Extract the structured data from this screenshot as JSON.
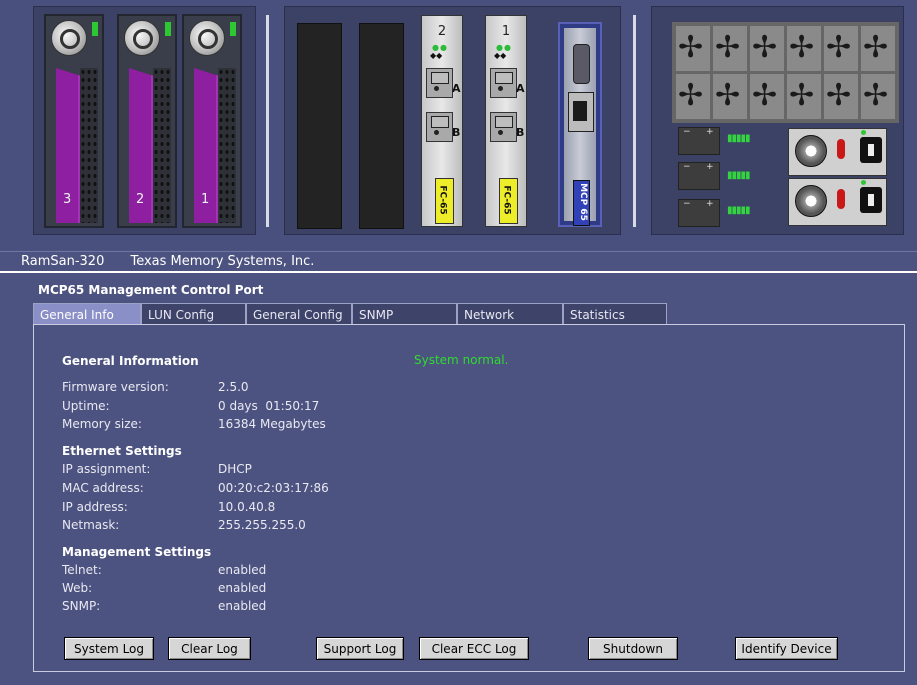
{
  "chassis": {
    "drive_bays": [
      "3",
      "2",
      "1"
    ],
    "fc_cards": [
      {
        "number": "2",
        "ports": [
          "A",
          "B"
        ],
        "label": "FC-65"
      },
      {
        "number": "1",
        "ports": [
          "A",
          "B"
        ],
        "label": "FC-65"
      }
    ],
    "mcp_label": "MCP 65",
    "fan_count": 12,
    "battery_count": 3,
    "psu_count": 2
  },
  "caption": {
    "model": "RamSan-320",
    "vendor": "Texas Memory Systems, Inc."
  },
  "management": {
    "title": "MCP65 Management Control Port",
    "tabs": [
      "General Info",
      "LUN Config",
      "General Config",
      "SNMP",
      "Network",
      "Statistics"
    ],
    "active_tab": "General Info"
  },
  "general": {
    "heading": "General Information",
    "status": "System normal.",
    "status_color": "#2edc2e",
    "firmware_label": "Firmware version:",
    "firmware": "2.5.0",
    "uptime_label": "Uptime:",
    "uptime": "0 days  01:50:17",
    "memory_label": "Memory size:",
    "memory": "16384 Megabytes"
  },
  "ethernet": {
    "heading": "Ethernet Settings",
    "ip_assign_label": "IP assignment:",
    "ip_assign": "DHCP",
    "mac_label": "MAC address:",
    "mac": "00:20:c2:03:17:86",
    "ip_label": "IP address:",
    "ip": "10.0.40.8",
    "netmask_label": "Netmask:",
    "netmask": "255.255.255.0"
  },
  "mgmt_settings": {
    "heading": "Management Settings",
    "telnet_label": "Telnet:",
    "telnet": "enabled",
    "web_label": "Web:",
    "web": "enabled",
    "snmp_label": "SNMP:",
    "snmp": "enabled"
  },
  "buttons": {
    "system_log": "System Log",
    "clear_log": "Clear Log",
    "support_log": "Support Log",
    "clear_ecc_log": "Clear ECC Log",
    "shutdown": "Shutdown",
    "identify": "Identify Device"
  }
}
